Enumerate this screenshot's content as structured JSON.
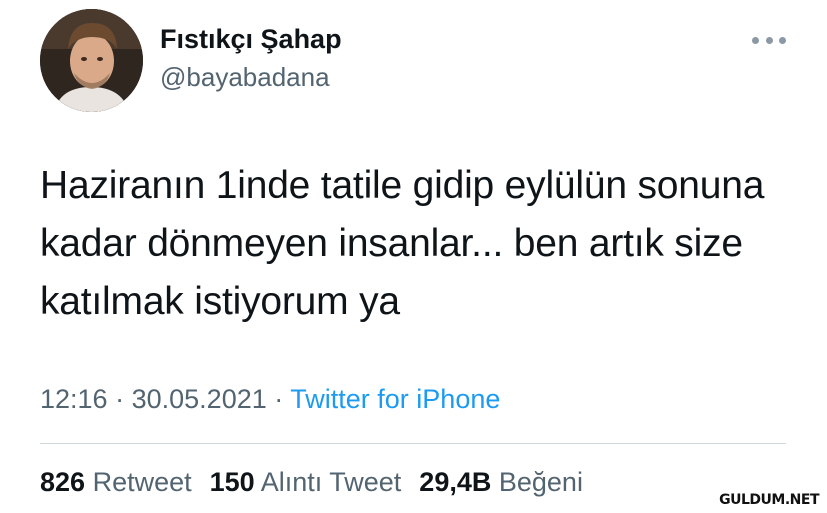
{
  "author": {
    "name": "Fıstıkçı Şahap",
    "handle": "@bayabadana"
  },
  "tweet": {
    "text": "Haziranın 1inde tatile gidip eylülün sonuna kadar dönmeyen insanlar... ben artık size katılmak istiyorum ya",
    "time": "12:16",
    "separator": "·",
    "date": "30.05.2021",
    "source": "Twitter for iPhone"
  },
  "stats": [
    {
      "count": "826",
      "label": "Retweet"
    },
    {
      "count": "150",
      "label": "Alıntı Tweet"
    },
    {
      "count": "29,4B",
      "label": "Beğeni"
    }
  ],
  "icons": {
    "more": "more-horizontal-icon",
    "avatar": "profile-avatar"
  },
  "colors": {
    "text": "#0f1419",
    "secondary": "#536471",
    "link": "#1d9bf0",
    "divider": "#cfd9de"
  },
  "watermark": "GULDUM.NET"
}
